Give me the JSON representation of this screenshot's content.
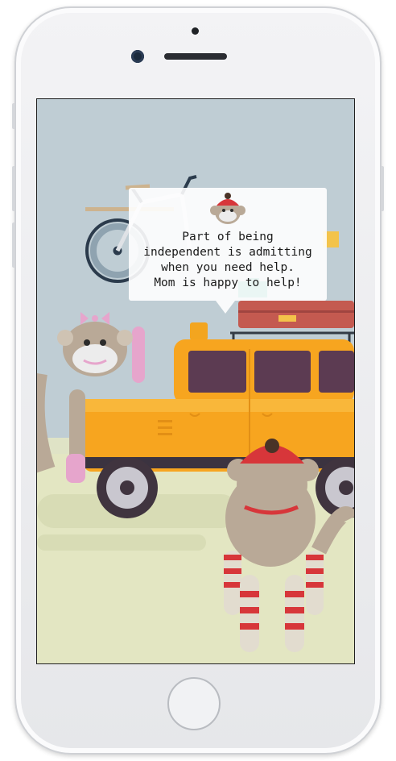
{
  "device": {
    "name": "smartphone"
  },
  "story": {
    "message_lines": [
      "Part of being",
      "independent is admitting",
      "when you need help.",
      "Mom is happy to help!"
    ]
  },
  "illustration": {
    "elements": [
      "bicycle",
      "luggage-rack",
      "yellow-jeep",
      "sock-monkey-pink",
      "sock-monkey-red-hat",
      "sock-monkey-avatar"
    ],
    "colors": {
      "sky": "#bfcdd4",
      "ground": "#e3e6c2",
      "jeep": "#f7a51f",
      "monkey": "#b9a997",
      "accent_red": "#d7363a",
      "accent_pink": "#e6a5cc"
    }
  }
}
